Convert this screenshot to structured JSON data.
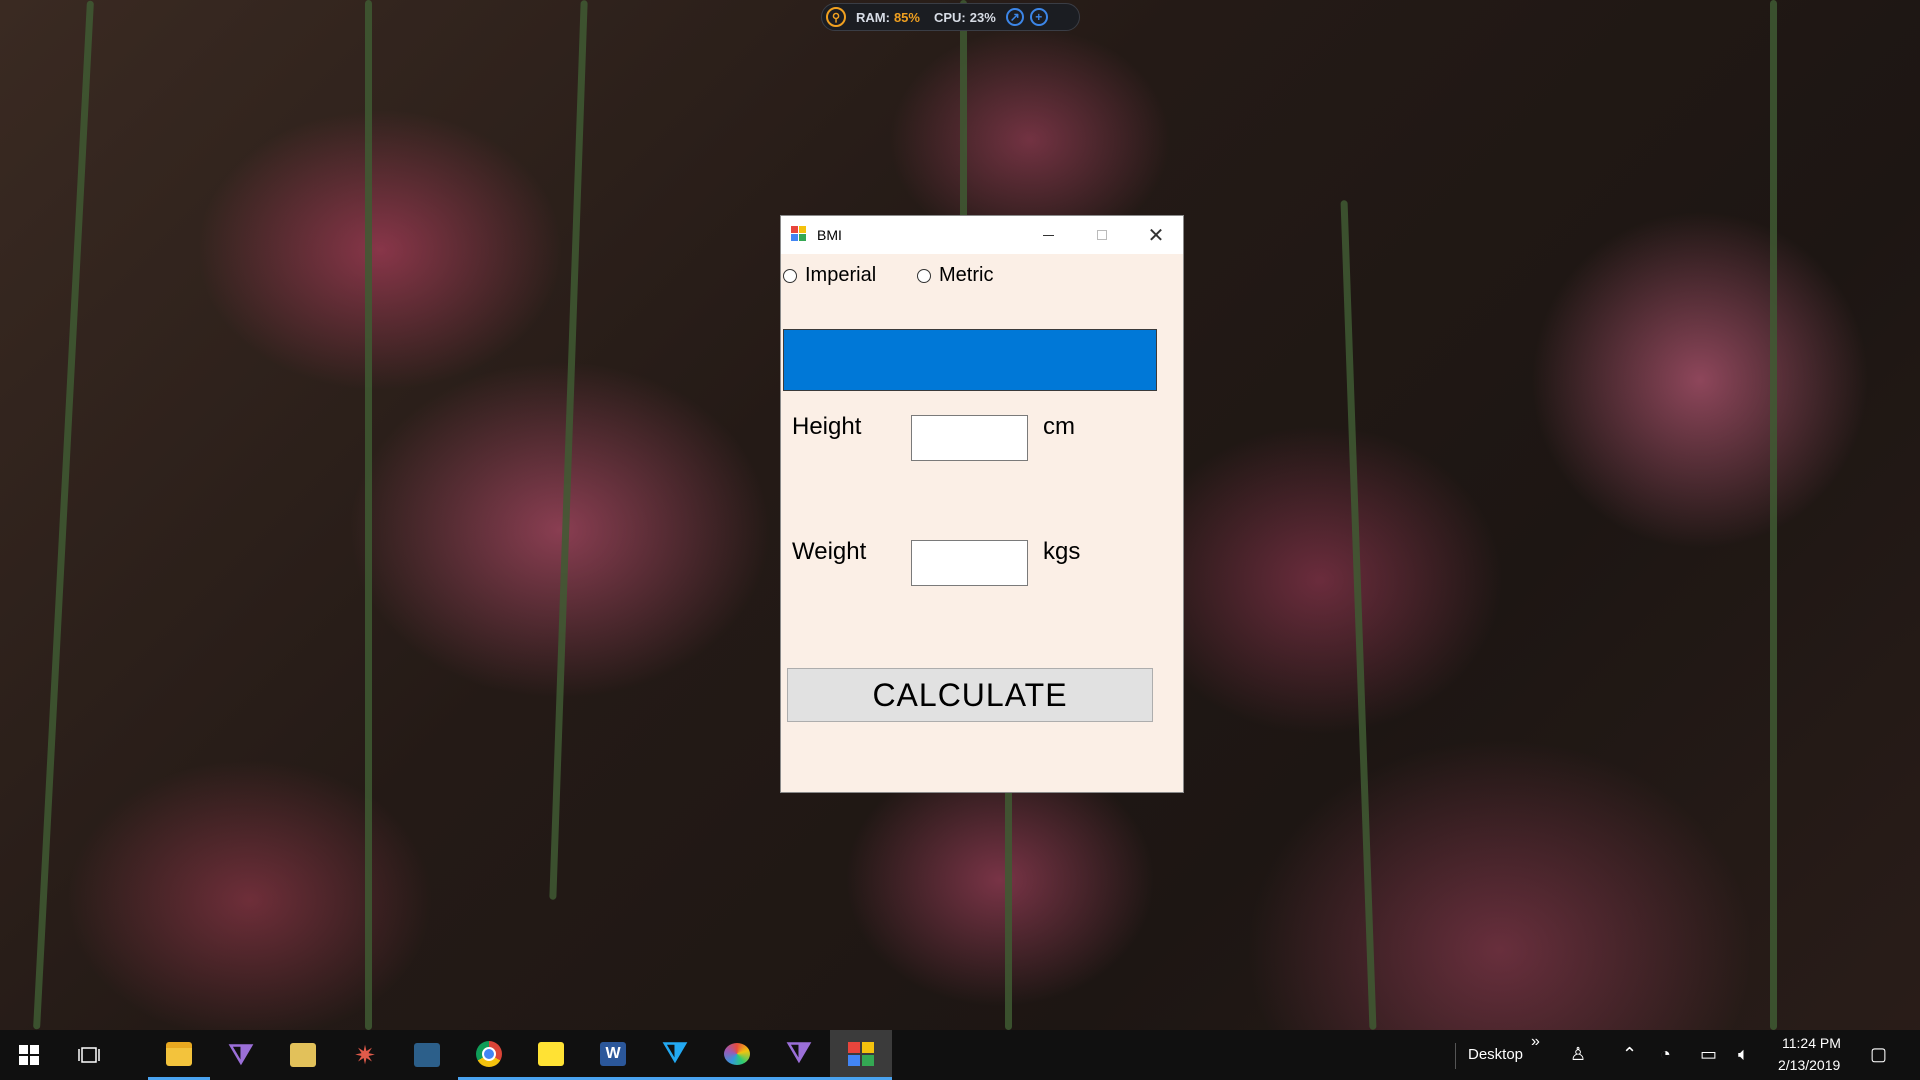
{
  "system_monitor": {
    "ram_label": "RAM:",
    "ram_value": "85%",
    "cpu_label": "CPU:",
    "cpu_value": "23%"
  },
  "window": {
    "title": "BMI",
    "controls": {
      "minimize": "minimize",
      "maximize": "maximize",
      "close": "close"
    }
  },
  "units": {
    "options": [
      {
        "label": "Imperial",
        "selected": false
      },
      {
        "label": "Metric",
        "selected": false
      }
    ]
  },
  "banner": {
    "color": "#0078d7"
  },
  "form": {
    "height_label": "Height",
    "height_value": "",
    "height_unit": "cm",
    "weight_label": "Weight",
    "weight_value": "",
    "weight_unit": "kgs",
    "calculate_label": "CALCULATE"
  },
  "taskbar": {
    "apps": [
      "start-icon",
      "task-view-icon",
      "file-explorer-icon",
      "visual-studio-icon",
      "tool-icon",
      "compass-icon",
      "azure-data-studio-icon",
      "chrome-icon",
      "sticky-notes-icon",
      "word-icon",
      "vscode-icon",
      "paint-icon",
      "visual-studio-icon",
      "bmi-app-icon"
    ],
    "toolbar_label": "Desktop",
    "toolbar_more": "»",
    "time": "11:24 PM",
    "date": "2/13/2019"
  }
}
